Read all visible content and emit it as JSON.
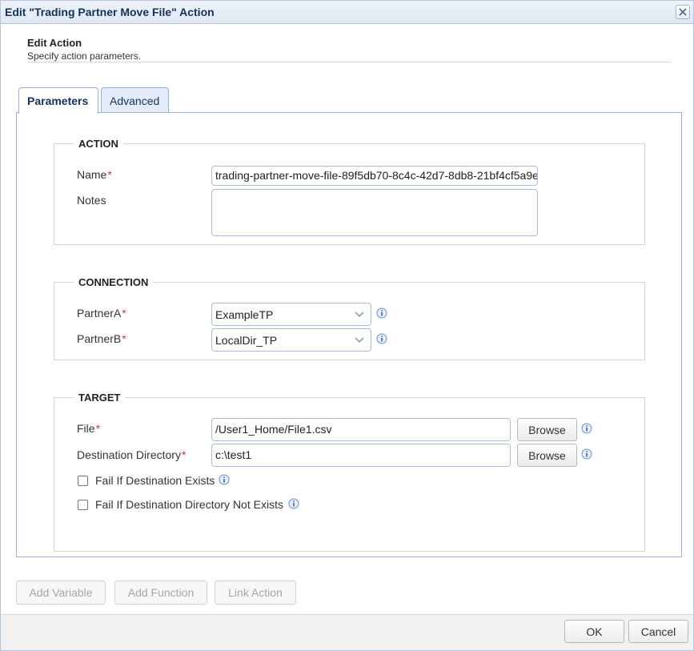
{
  "window": {
    "title": "Edit \"Trading Partner Move File\" Action"
  },
  "header": {
    "title": "Edit Action",
    "subtitle": "Specify action parameters."
  },
  "tabs": [
    {
      "label": "Parameters",
      "active": true
    },
    {
      "label": "Advanced",
      "active": false
    }
  ],
  "action": {
    "legend": "ACTION",
    "name_label": "Name",
    "name_value": "trading-partner-move-file-89f5db70-8c4c-42d7-8db8-21bf4cf5a9e",
    "notes_label": "Notes",
    "notes_value": ""
  },
  "connection": {
    "legend": "CONNECTION",
    "partner_a_label": "PartnerA",
    "partner_a_value": "ExampleTP",
    "partner_b_label": "PartnerB",
    "partner_b_value": "LocalDir_TP"
  },
  "target": {
    "legend": "TARGET",
    "file_label": "File",
    "file_value": "/User1_Home/File1.csv",
    "dest_label": "Destination Directory",
    "dest_value": "c:\\test1",
    "browse_label": "Browse",
    "fail_exists_label": "Fail If Destination Exists",
    "fail_exists_checked": false,
    "fail_not_exists_label": "Fail If Destination Directory Not Exists",
    "fail_not_exists_checked": false
  },
  "required_marker": "*",
  "toolbar": {
    "add_variable": "Add Variable",
    "add_function": "Add Function",
    "link_action": "Link Action"
  },
  "footer": {
    "ok": "OK",
    "cancel": "Cancel"
  },
  "icons": {
    "close": "close-icon",
    "info": "info-icon",
    "dropdown": "chevron-down-icon"
  },
  "colors": {
    "required": "#dd3333",
    "title": "#15315a",
    "border": "#99b3d6"
  }
}
